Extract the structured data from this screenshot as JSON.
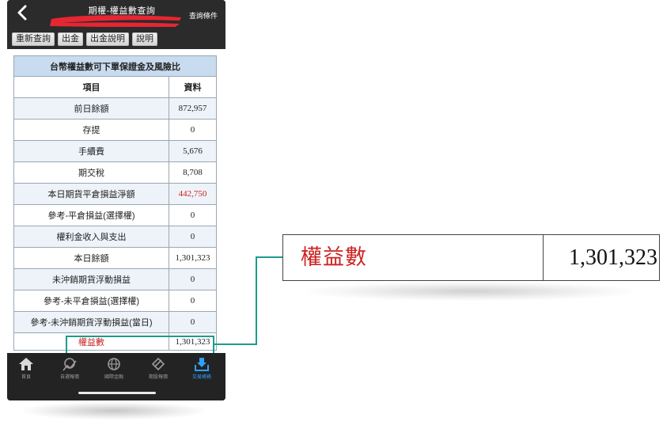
{
  "header": {
    "title": "期權-權益數查詢",
    "query_condition": "查詢條件",
    "back_icon": "chevron-left-icon"
  },
  "toolbar": {
    "buttons": [
      "重新查詢",
      "出金",
      "出金說明",
      "說明"
    ]
  },
  "table": {
    "title": "台幣權益數可下單保證金及風險比",
    "headers": [
      "項目",
      "資料"
    ],
    "rows": [
      {
        "item": "前日餘額",
        "value": "872,957"
      },
      {
        "item": "存提",
        "value": "0"
      },
      {
        "item": "手續費",
        "value": "5,676"
      },
      {
        "item": "期交稅",
        "value": "8,708"
      },
      {
        "item": "本日期貨平倉損益淨額",
        "value": "442,750",
        "color": "#cc2222"
      },
      {
        "item": "參考-平倉損益(選擇權)",
        "value": "0"
      },
      {
        "item": "權利金收入與支出",
        "value": "0"
      },
      {
        "item": "本日餘額",
        "value": "1,301,323"
      },
      {
        "item": "未沖銷期貨浮動損益",
        "value": "0"
      },
      {
        "item": "參考-未平倉損益(選擇權)",
        "value": "0"
      },
      {
        "item": "參考-未沖銷期貨浮動損益(當日)",
        "value": "0"
      },
      {
        "item": "權益數",
        "value": "1,301,323",
        "color": "#cc2222"
      }
    ]
  },
  "bottom_nav": [
    {
      "label": "首頁",
      "icon": "home-icon"
    },
    {
      "label": "自選報價",
      "icon": "stock-quote-icon"
    },
    {
      "label": "國際金融",
      "icon": "globe-icon"
    },
    {
      "label": "期股報價",
      "icon": "futures-icon"
    },
    {
      "label": "交易帳務",
      "icon": "trade-account-icon",
      "active": true
    }
  ],
  "callout": {
    "label": "權益數",
    "value": "1,301,323"
  },
  "colors": {
    "accent_red": "#cc2222",
    "highlight": "#1c9c8c",
    "table_header_bg": "#c8dbef",
    "active_nav": "#2ea0ff"
  }
}
